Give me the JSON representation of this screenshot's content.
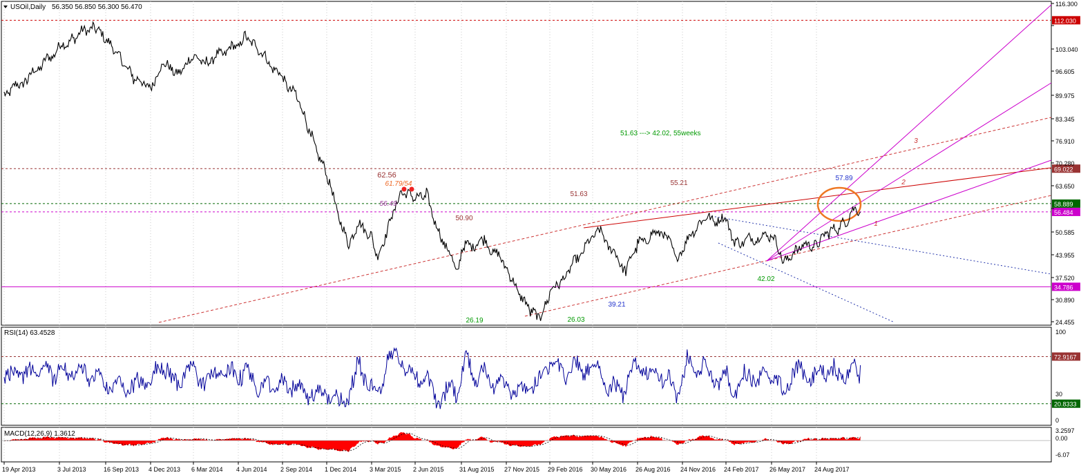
{
  "main_header": {
    "symbol": "USOil,Daily",
    "ohlc": "56.350 56.850 56.300 56.470"
  },
  "rsi_header": "RSI(14) 63.4528",
  "macd_header": "MACD(12,26,9) 1.3612",
  "chart_data": [
    {
      "type": "line",
      "pane": "price",
      "series": [
        {
          "color": "#000000",
          "points": [
            [
              "19 Apr 2013",
              90.5
            ],
            [
              "20 May 2013",
              95.0
            ],
            [
              "3 Jul 2013",
              104.0
            ],
            [
              "25 Jul 2013",
              107.0
            ],
            [
              "28 Aug 2013",
              110.5
            ],
            [
              "16 Sep 2013",
              106.0
            ],
            [
              "10 Oct 2013",
              102.0
            ],
            [
              "4 Nov 2013",
              95.0
            ],
            [
              "4 Dec 2013",
              93.0
            ],
            [
              "1 Jan 2014",
              99.0
            ],
            [
              "1 Feb 2014",
              97.0
            ],
            [
              "6 Mar 2014",
              101.0
            ],
            [
              "1 Apr 2014",
              100.0
            ],
            [
              "4 Jun 2014",
              105.0
            ],
            [
              "20 Jun 2014",
              107.5
            ],
            [
              "15 Jul 2014",
              103.5
            ],
            [
              "2 Sep 2014",
              95.0
            ],
            [
              "1 Oct 2014",
              90.0
            ],
            [
              "1 Nov 2014",
              78.0
            ],
            [
              "1 Dec 2014",
              67.0
            ],
            [
              "15 Jan 2015",
              46.0
            ],
            [
              "1 Feb 2015",
              53.0
            ],
            [
              "3 Mar 2015",
              50.0
            ],
            [
              "16 Mar 2015",
              43.0
            ],
            [
              "15 Apr 2015",
              56.0
            ],
            [
              "6 May 2015",
              62.5
            ],
            [
              "2 Jun 2015",
              60.0
            ],
            [
              "24 Jun 2015",
              61.5
            ],
            [
              "15 Jul 2015",
              52.0
            ],
            [
              "24 Aug 2015",
              39.0
            ],
            [
              "31 Aug 2015",
              46.0
            ],
            [
              "15 Oct 2015",
              48.0
            ],
            [
              "27 Nov 2015",
              41.0
            ],
            [
              "20 Dec 2015",
              34.0
            ],
            [
              "20 Jan 2016",
              27.0
            ],
            [
              "11 Feb 2016",
              26.2
            ],
            [
              "29 Feb 2016",
              33.0
            ],
            [
              "1 Apr 2016",
              38.0
            ],
            [
              "30 May 2016",
              49.0
            ],
            [
              "9 Jun 2016",
              51.5
            ],
            [
              "3 Aug 2016",
              39.5
            ],
            [
              "26 Aug 2016",
              47.0
            ],
            [
              "15 Oct 2016",
              51.5
            ],
            [
              "14 Nov 2016",
              42.5
            ],
            [
              "24 Nov 2016",
              46.0
            ],
            [
              "3 Jan 2017",
              54.5
            ],
            [
              "24 Feb 2017",
              54.0
            ],
            [
              "15 Mar 2017",
              47.5
            ],
            [
              "26 May 2017",
              50.0
            ],
            [
              "21 Jun 2017",
              42.0
            ],
            [
              "15 Jul 2017",
              46.0
            ],
            [
              "24 Aug 2017",
              47.5
            ],
            [
              "20 Sep 2017",
              50.5
            ],
            [
              "10 Oct 2017",
              52.0
            ],
            [
              "25 Oct 2017",
              54.0
            ],
            [
              "3 Nov 2017",
              56.5
            ],
            [
              "10 Nov 2017",
              57.9
            ],
            [
              "20 Nov 2017",
              56.47
            ]
          ]
        }
      ],
      "x_tick_labels": [
        "19 Apr 2013",
        "3 Jul 2013",
        "16 Sep 2013",
        "4 Dec 2013",
        "6 Mar 2014",
        "4 Jun 2014",
        "2 Sep 2014",
        "1 Dec 2014",
        "3 Mar 2015",
        "2 Jun 2015",
        "31 Aug 2015",
        "27 Nov 2015",
        "29 Feb 2016",
        "30 May 2016",
        "26 Aug 2016",
        "24 Nov 2016",
        "24 Feb 2017",
        "26 May 2017",
        "24 Aug 2017"
      ],
      "y_tick_labels": [
        "116.300",
        "109.675",
        "103.040",
        "96.605",
        "89.975",
        "83.345",
        "76.910",
        "70.280",
        "63.650",
        "57.215",
        "50.585",
        "43.955",
        "37.520",
        "30.890",
        "24.455"
      ],
      "ylim": [
        24.455,
        116.3
      ],
      "horizontal_levels": [
        {
          "value": 112.03,
          "label": "112.030",
          "color": "#cc0000",
          "style": "dashed"
        },
        {
          "value": 69.022,
          "label": "69.022",
          "color": "#993333",
          "style": "dashed"
        },
        {
          "value": 58.889,
          "label": "58.889",
          "color": "#006600",
          "style": "dashed"
        },
        {
          "value": 56.484,
          "label": "56.484",
          "color": "#cc00cc",
          "style": "dashed"
        },
        {
          "value": 34.786,
          "label": "34.786",
          "color": "#cc00cc",
          "style": "solid"
        }
      ],
      "annotations": [
        {
          "text": "62.56",
          "color": "#993333"
        },
        {
          "text": "61.79/54",
          "color": "#ee6622"
        },
        {
          "text": "56.49",
          "color": "#993399"
        },
        {
          "text": "50.90",
          "color": "#993333"
        },
        {
          "text": "51.63",
          "color": "#993333"
        },
        {
          "text": "55.21",
          "color": "#993333"
        },
        {
          "text": "57.89",
          "color": "#2233cc"
        },
        {
          "text": "42.02",
          "color": "#009900"
        },
        {
          "text": "39.21",
          "color": "#2233cc"
        },
        {
          "text": "26.19",
          "color": "#009900"
        },
        {
          "text": "26.03",
          "color": "#009900"
        },
        {
          "text": "51.63 ---> 42.02,  55weeks",
          "color": "#009900"
        },
        {
          "text": "1",
          "color": "#cc3333"
        },
        {
          "text": "2",
          "color": "#cc3333"
        },
        {
          "text": "3",
          "color": "#cc3333"
        }
      ]
    },
    {
      "type": "line",
      "pane": "rsi",
      "series": [
        {
          "name": "RSI(14)",
          "color": "#000099"
        }
      ],
      "y_tick_labels": [
        "100",
        "30",
        "0"
      ],
      "ylim": [
        0,
        100
      ],
      "horizontal_levels": [
        {
          "value": 72.9167,
          "label": "72.9167",
          "color": "#993333",
          "style": "dashed"
        },
        {
          "value": 20.8333,
          "label": "20.8333",
          "color": "#006600",
          "style": "dashed"
        }
      ],
      "last_value": 63.4528
    },
    {
      "type": "area",
      "pane": "macd",
      "series": [
        {
          "name": "MACD(12,26,9)",
          "color": "#ff0000"
        }
      ],
      "y_tick_labels": [
        "3.2597",
        "0.00",
        "-6.07"
      ],
      "ylim": [
        -6.07,
        3.2597
      ],
      "last_value": 1.3612
    }
  ]
}
